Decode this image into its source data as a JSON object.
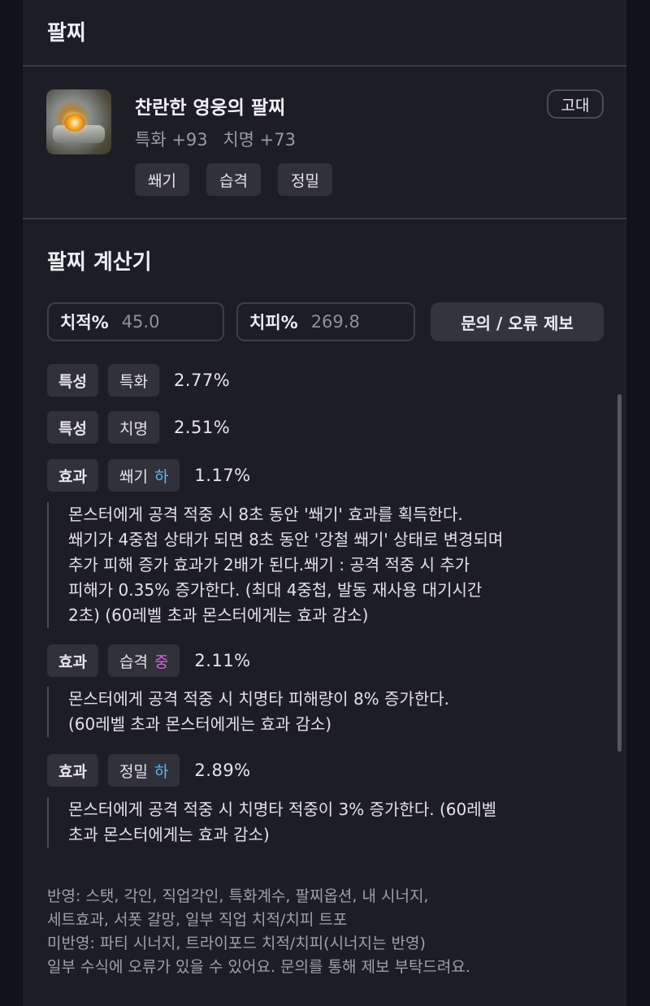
{
  "header": {
    "title": "팔찌"
  },
  "item": {
    "name": "찬란한 영웅의 팔찌",
    "stats": [
      "특화 +93",
      "치명 +73"
    ],
    "grade": "고대",
    "tags": [
      "쐐기",
      "습격",
      "정밀"
    ],
    "icon": "bracelet-icon"
  },
  "calculator": {
    "title": "팔찌 계산기",
    "crit_rate": {
      "label": "치적%",
      "value": "45.0"
    },
    "crit_damage": {
      "label": "치피%",
      "value": "269.8"
    },
    "report_button": "문의 / 오류 제보"
  },
  "rows": [
    {
      "type": "특성",
      "name": "특화",
      "grade": "",
      "value": "2.77%"
    },
    {
      "type": "특성",
      "name": "치명",
      "grade": "",
      "value": "2.51%"
    },
    {
      "type": "효과",
      "name": "쐐기",
      "grade": "하",
      "value": "1.17%",
      "desc": [
        "몬스터에게 공격 적중 시 8초 동안 '쐐기' 효과를 획득한다.",
        "쐐기가 4중첩 상태가 되면 8초 동안 '강철 쐐기' 상태로 변경되며",
        "추가 피해 증가 효과가 2배가 된다.쐐기 : 공격 적중 시 추가",
        "피해가 0.35% 증가한다. (최대 4중첩, 발동 재사용 대기시간",
        "2초) (60레벨 초과 몬스터에게는 효과 감소)"
      ]
    },
    {
      "type": "효과",
      "name": "습격",
      "grade": "중",
      "value": "2.11%",
      "desc": [
        "몬스터에게 공격 적중 시 치명타 피해량이 8% 증가한다.",
        "(60레벨 초과 몬스터에게는 효과 감소)"
      ]
    },
    {
      "type": "효과",
      "name": "정밀",
      "grade": "하",
      "value": "2.89%",
      "desc": [
        "몬스터에게 공격 적중 시 치명타 적중이 3% 증가한다. (60레벨",
        "초과 몬스터에게는 효과 감소)"
      ]
    }
  ],
  "footer": [
    "반영: 스탯, 각인, 직업각인, 특화계수, 팔찌옵션, 내 시너지,",
    "세트효과, 서폿 갈망, 일부 직업 치적/치피 트포",
    "미반영: 파티 시너지, 트라이포드 치적/치피(시너지는 반영)",
    "일부 수식에 오류가 있을 수 있어요. 문의를 통해 제보 부탁드려요."
  ],
  "colors": {
    "grade_low": "#5fb8f2",
    "grade_mid": "#e05ee0",
    "background": "#1d1e25"
  }
}
